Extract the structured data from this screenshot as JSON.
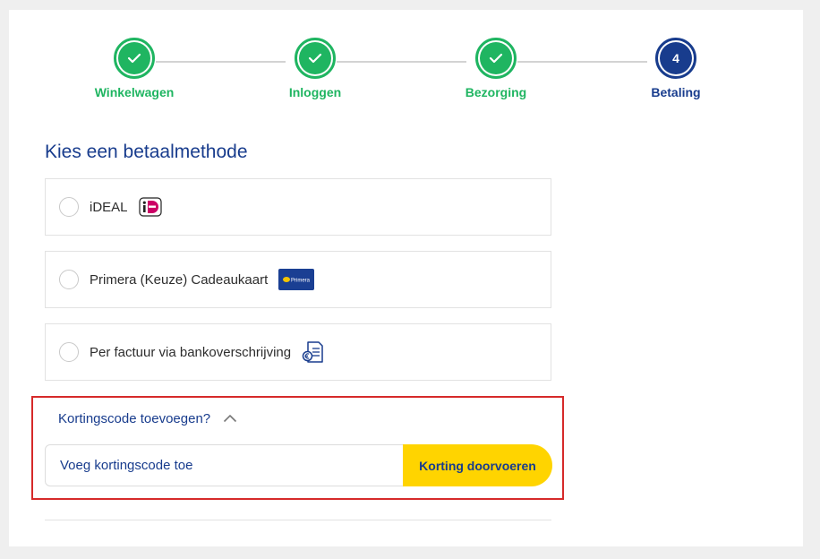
{
  "stepper": {
    "steps": [
      {
        "label": "Winkelwagen",
        "status": "done"
      },
      {
        "label": "Inloggen",
        "status": "done"
      },
      {
        "label": "Bezorging",
        "status": "done"
      },
      {
        "label": "Betaling",
        "status": "current",
        "number": "4"
      }
    ]
  },
  "payment": {
    "title": "Kies een betaalmethode",
    "options": [
      {
        "label": "iDEAL",
        "icon": "ideal-logo"
      },
      {
        "label": "Primera (Keuze) Cadeaukaart",
        "icon": "primera-logo",
        "icon_text": "Primera"
      },
      {
        "label": "Per factuur via bankoverschrijving",
        "icon": "invoice-icon"
      }
    ]
  },
  "promo": {
    "toggle_label": "Kortingscode toevoegen?",
    "input_placeholder": "Voeg kortingscode toe",
    "button_label": "Korting doorvoeren"
  },
  "colors": {
    "success": "#1fb561",
    "brand": "#183c8d",
    "cta": "#ffd400",
    "highlight": "#d62a2a"
  }
}
